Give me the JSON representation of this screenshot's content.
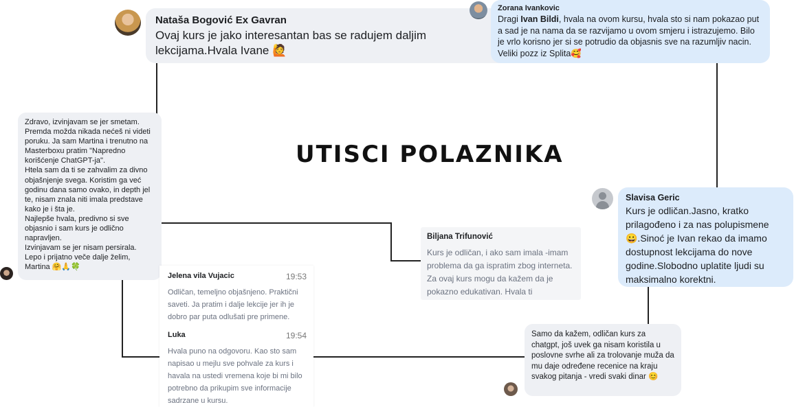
{
  "title": "UTISCI POLAZNIKA",
  "comments": {
    "natasa": {
      "name": "Nataša Bogović Ex Gavran",
      "text": "Ovaj kurs je jako interesantan bas se radujem daljim lekcijama.Hvala Ivane 🙋"
    },
    "zorana": {
      "name": "Zorana Ivankovic",
      "text_prefix": "Dragi ",
      "text_bold": "Ivan Bildi",
      "text_suffix": ", hvala na ovom kursu, hvala sto si nam pokazao put a sad je na nama da se razvijamo u ovom smjeru i istrazujemo. Bilo je vrlo korisno jer si se potrudio da objasnis sve na razumljiv nacin. Veliki pozz iz Splita🥰"
    },
    "martina": {
      "lines": [
        "Zdravo, izvinjavam se jer smetam.",
        "Premda možda nikada nećeš ni videti",
        "poruku. Ja sam Martina i trenutno na",
        "Masterboxu pratim \"Napredno",
        "korišćenje ChatGPT-ja\".",
        "Htela sam da ti se zahvalim za divno",
        "objašnjenje svega. Koristim ga već",
        "godinu dana samo ovako, in depth jel",
        "te, nisam znala niti imala predstave",
        "kako je i šta je.",
        "Najlepše hvala, predivno si sve",
        "objasnio i sam kurs je odlično",
        "napravljen.",
        "Izvinjavam se jer nisam persirala.",
        "Lepo i prijatno veče dalje želim,",
        "Martina 🤗🙏🍀"
      ]
    },
    "slavisa": {
      "name": "Slavisa Geric",
      "text": "Kurs je odličan.Jasno, kratko prilagođeno i za nas polupismene 😀.Sinoć je Ivan rekao da imamo dostupnost lekcijama do nove godine.Slobodno uplatite ljudi su maksimalno korektni."
    },
    "biljana": {
      "name": "Biljana Trifunović",
      "text": "Kurs je odličan, i ako sam imala -imam problema da ga ispratim zbog interneta. Za ovaj kurs mogu da kažem da je pokazno edukativan. Hvala ti"
    },
    "jelena": {
      "name": "Jelena vila Vujacic",
      "time": "19:53",
      "text": "Odličan, temeljno objašnjeno. Praktični saveti. Ja pratim i dalje lekcije jer ih je dobro par puta odlušati pre primene."
    },
    "luka": {
      "name": "Luka",
      "time": "19:54",
      "text": "Hvala puno na odgovoru. Kao sto sam napisao u mejlu sve pohvale za kurs i havala na ustedi vremena koje bi mi bilo potrebno da prikupim sve informacije sadrzane u kursu."
    },
    "anon": {
      "text": "Samo da kažem, odličan kurs za chatgpt, još uvek ga nisam koristila u poslovne svrhe ali za trolovanje muža da mu daje određene recenice na kraju svakog pitanja - vredi svaki dinar 😊"
    }
  },
  "colors": {
    "bubble_gray": "#eef0f4",
    "bubble_blue": "#dcebfb",
    "line": "#222222"
  }
}
